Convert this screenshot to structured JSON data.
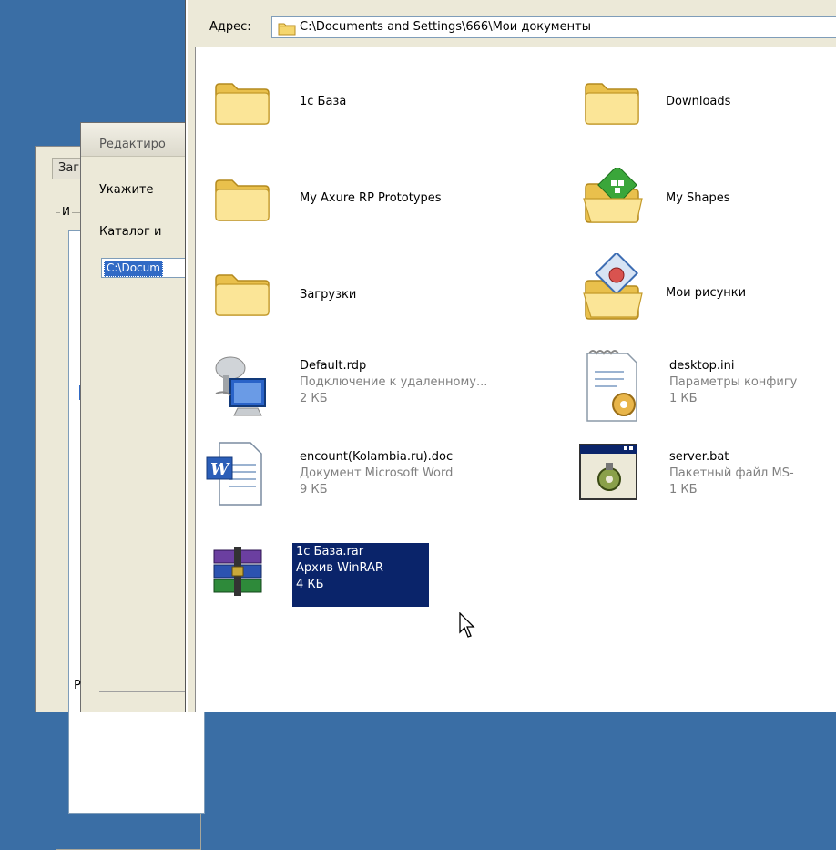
{
  "background_dialogs": {
    "back": {
      "tab_label": "Заг",
      "group_label": "И"
    },
    "mid": {
      "title": "Редактиро",
      "label1": "Укажите ",
      "label2": "Каталог и",
      "field_value": "C:\\Docum",
      "bottom_letter": "Р"
    }
  },
  "address": {
    "label": "Адрес:",
    "path": "C:\\Documents and Settings\\666\\Мои документы"
  },
  "items": [
    {
      "name": "1c База",
      "icon": "folder-icon"
    },
    {
      "name": "Downloads",
      "icon": "folder-icon"
    },
    {
      "name": "My Axure RP Prototypes",
      "icon": "folder-icon"
    },
    {
      "name": "My Shapes",
      "icon": "shapes-folder-icon"
    },
    {
      "name": "Загрузки",
      "icon": "folder-icon"
    },
    {
      "name": "Мои рисунки",
      "icon": "pictures-folder-icon"
    },
    {
      "name": "Default.rdp",
      "type": "Подключение к удаленному...",
      "size": "2 КБ",
      "icon": "remote-desktop-icon"
    },
    {
      "name": "desktop.ini",
      "type": "Параметры конфигу",
      "size": "1 КБ",
      "icon": "ini-file-icon"
    },
    {
      "name": "encount(Kolambia.ru).doc",
      "type": "Документ Microsoft Word",
      "size": "9 КБ",
      "icon": "word-document-icon"
    },
    {
      "name": "server.bat",
      "type": "Пакетный файл MS-",
      "size": "1 КБ",
      "icon": "batch-file-icon"
    },
    {
      "name": "1c База.rar",
      "type": "Архив WinRAR",
      "size": "4 КБ",
      "icon": "winrar-archive-icon",
      "selected": true
    }
  ],
  "colors": {
    "desktop": "#3a6ea5",
    "selection": "#0a246a",
    "folder": "#f5d66e"
  }
}
